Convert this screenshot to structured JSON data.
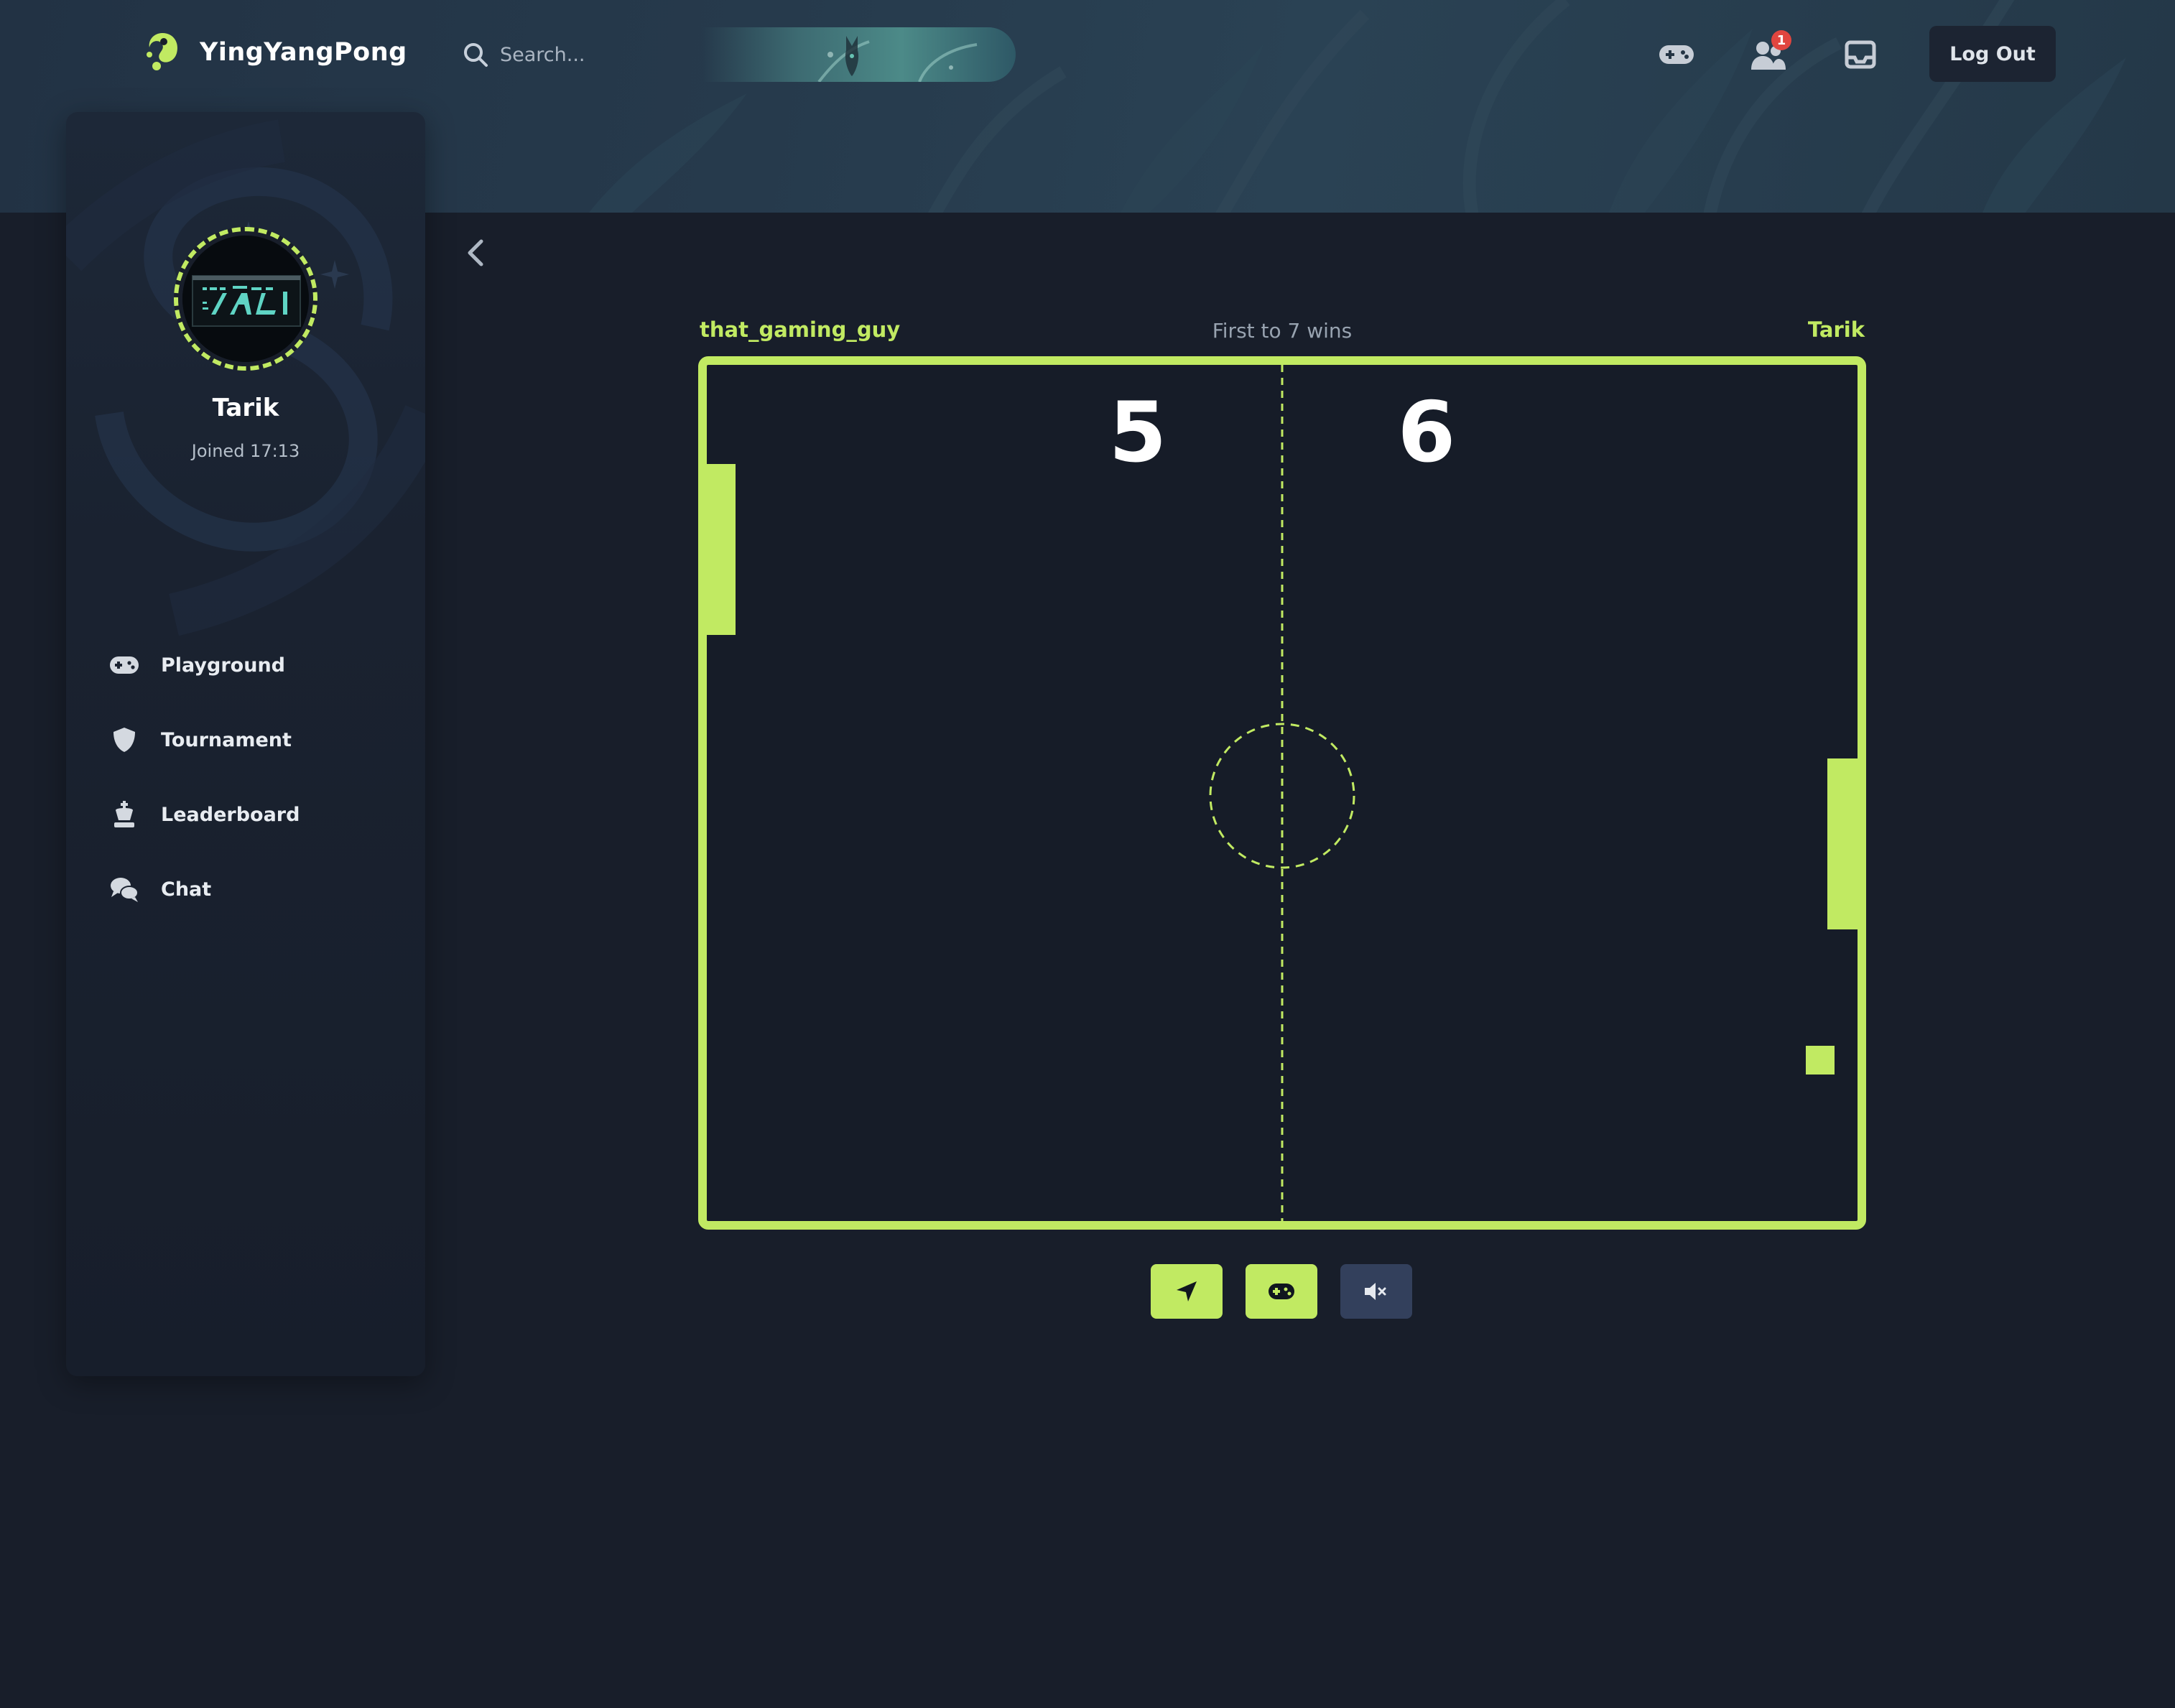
{
  "header": {
    "brand": "YingYangPong",
    "search_placeholder": "Search...",
    "notifications_count": "1",
    "logout_label": "Log Out",
    "icons": [
      "gamepad-icon",
      "friends-icon",
      "inbox-icon"
    ]
  },
  "sidebar": {
    "username": "Tarik",
    "joined": "Joined 17:13",
    "items": [
      {
        "label": "Playground",
        "icon": "gamepad-icon"
      },
      {
        "label": "Tournament",
        "icon": "shield-icon"
      },
      {
        "label": "Leaderboard",
        "icon": "chess-king-icon"
      },
      {
        "label": "Chat",
        "icon": "chat-bubbles-icon"
      }
    ]
  },
  "game": {
    "player_left": "that_gaming_guy",
    "player_right": "Tarik",
    "rule": "First to 7 wins",
    "score_left": "5",
    "score_right": "6",
    "controls": [
      "send-icon",
      "gamepad-icon",
      "mute-icon"
    ]
  },
  "colors": {
    "accent": "#c1ea62",
    "background": "#181e2a",
    "badge": "#e0453f",
    "court": "#161c28"
  }
}
